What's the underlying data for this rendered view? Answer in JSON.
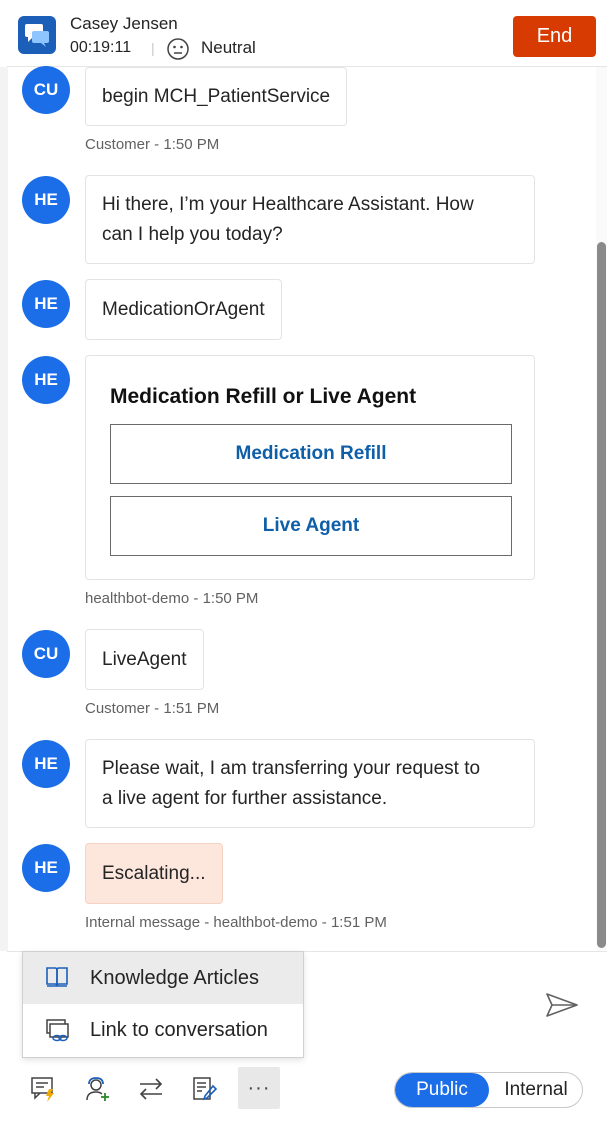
{
  "header": {
    "contact_name": "Casey Jensen",
    "timer": "00:19:11",
    "separator": "|",
    "sentiment": "Neutral",
    "end_label": "End",
    "app_icon": "chat-bubbles-icon",
    "sentiment_icon": "neutral-face-icon"
  },
  "messages": [
    {
      "avatar": "CU",
      "text": "begin MCH_PatientService",
      "meta": "Customer - 1:50 PM"
    },
    {
      "avatar": "HE",
      "lines": [
        "Hi there, I’m your Healthcare Assistant. How",
        "can I help you today?"
      ]
    },
    {
      "avatar": "HE",
      "text": "MedicationOrAgent"
    },
    {
      "avatar": "HE",
      "card": {
        "title": "Medication Refill or Live Agent",
        "buttons": [
          "Medication Refill",
          "Live Agent"
        ]
      },
      "meta": "healthbot-demo - 1:50 PM"
    },
    {
      "avatar": "CU",
      "text": "LiveAgent",
      "meta": "Customer - 1:51 PM"
    },
    {
      "avatar": "HE",
      "lines": [
        "Please wait, I am transferring your request to",
        "a live agent for further assistance."
      ]
    },
    {
      "avatar": "HE",
      "text": "Escalating...",
      "meta": "Internal message - healthbot-demo - 1:51 PM"
    }
  ],
  "popup_menu": {
    "items": [
      {
        "label": "Knowledge Articles",
        "icon": "book-icon",
        "selected": true
      },
      {
        "label": "Link to conversation",
        "icon": "link-conversation-icon",
        "selected": false
      }
    ]
  },
  "toolbar": {
    "icons": [
      "quick-replies-icon",
      "consult-agent-icon",
      "transfer-icon",
      "notes-icon"
    ],
    "more_label": "···",
    "send_icon": "send-icon"
  },
  "mode_toggle": {
    "public_label": "Public",
    "internal_label": "Internal",
    "selected": "Public"
  },
  "colors": {
    "accent": "#1b6ee8",
    "end_button": "#d83b01",
    "card_button_text": "#0f5ea8",
    "escalating_bg": "#fde7dc"
  }
}
